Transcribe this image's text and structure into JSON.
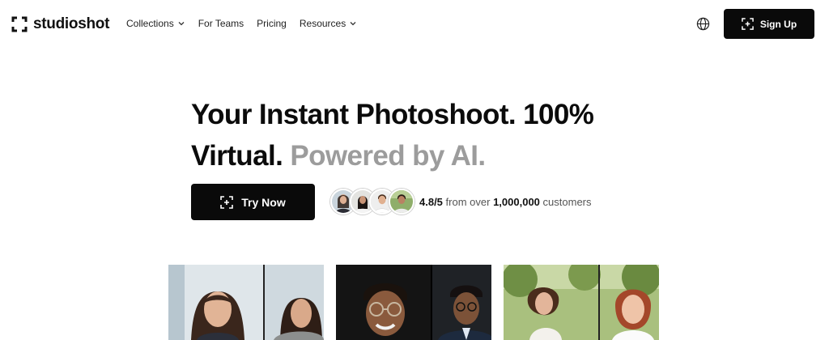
{
  "brand": {
    "name": "studioshot",
    "icon": "viewfinder-logo-icon"
  },
  "nav": {
    "links": [
      {
        "label": "Collections",
        "dropdown": true
      },
      {
        "label": "For Teams",
        "dropdown": false
      },
      {
        "label": "Pricing",
        "dropdown": false
      },
      {
        "label": "Resources",
        "dropdown": true
      }
    ],
    "language_icon": "globe-icon",
    "signup_label": "Sign Up"
  },
  "hero": {
    "headline_part1": "Your Instant Photoshoot. 100% Virtual.",
    "headline_part2": "Powered by AI.",
    "cta_label": "Try Now",
    "rating_score": "4.8/5",
    "rating_text": "from over",
    "rating_count": "1,000,000",
    "rating_suffix": "customers"
  },
  "colors": {
    "primary": "#0a0a0a",
    "muted_text": "#9c9c9c",
    "background": "#ffffff"
  }
}
